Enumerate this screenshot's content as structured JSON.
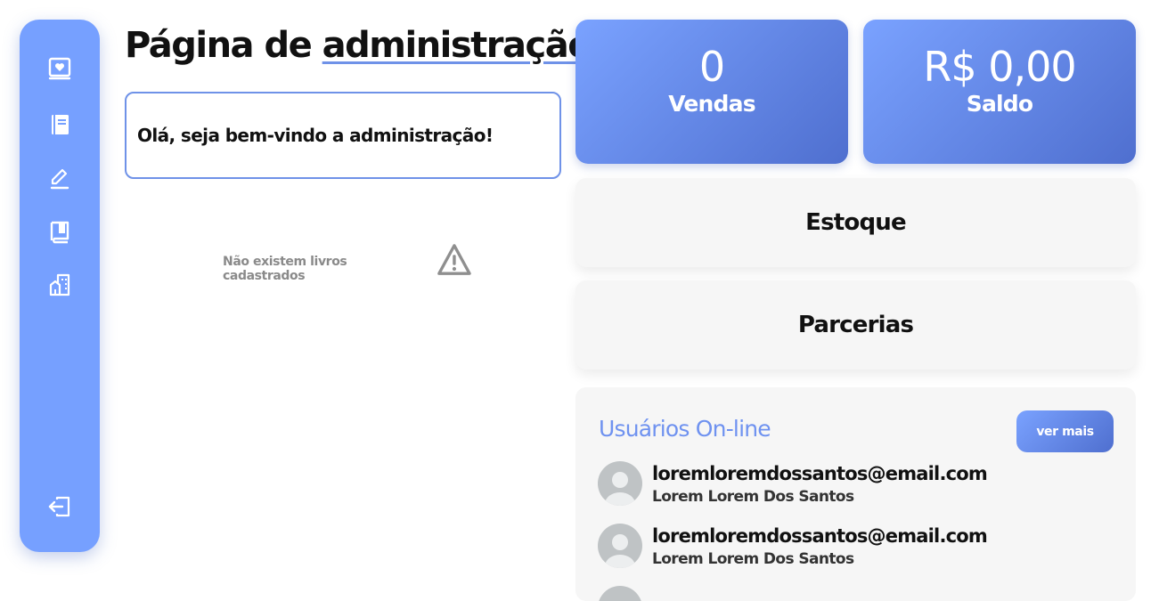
{
  "sidebar": {
    "items": [
      {
        "icon": "book-heart-icon",
        "name": "sidebar-item-home"
      },
      {
        "icon": "notebook-icon",
        "name": "sidebar-item-catalog"
      },
      {
        "icon": "pencil-icon",
        "name": "sidebar-item-edit"
      },
      {
        "icon": "book-icon",
        "name": "sidebar-item-books"
      },
      {
        "icon": "building-icon",
        "name": "sidebar-item-partners"
      }
    ],
    "logout_icon": "logout-icon"
  },
  "header": {
    "title_part1": "Página de ",
    "title_part2": "administração"
  },
  "welcome": {
    "message": "Olá, seja bem-vindo a administração!"
  },
  "books": {
    "empty_message": "Não existem livros cadastrados"
  },
  "stats": {
    "sales_value": "0",
    "sales_label": "Vendas",
    "balance_value": "R$ 0,00",
    "balance_label": "Saldo"
  },
  "panels": {
    "stock": "Estoque",
    "partnerships": "Parcerias"
  },
  "online_users": {
    "title": "Usuários On-line",
    "more_button": "ver mais",
    "users": [
      {
        "email": "loremloremdossantos@email.com",
        "name": "Lorem Lorem Dos Santos"
      },
      {
        "email": "loremloremdossantos@email.com",
        "name": "Lorem Lorem Dos Santos"
      }
    ]
  },
  "colors": {
    "accent": "#76a0ff",
    "accent_dark": "#4f6fcf",
    "panel_bg": "#f6f6f6"
  }
}
